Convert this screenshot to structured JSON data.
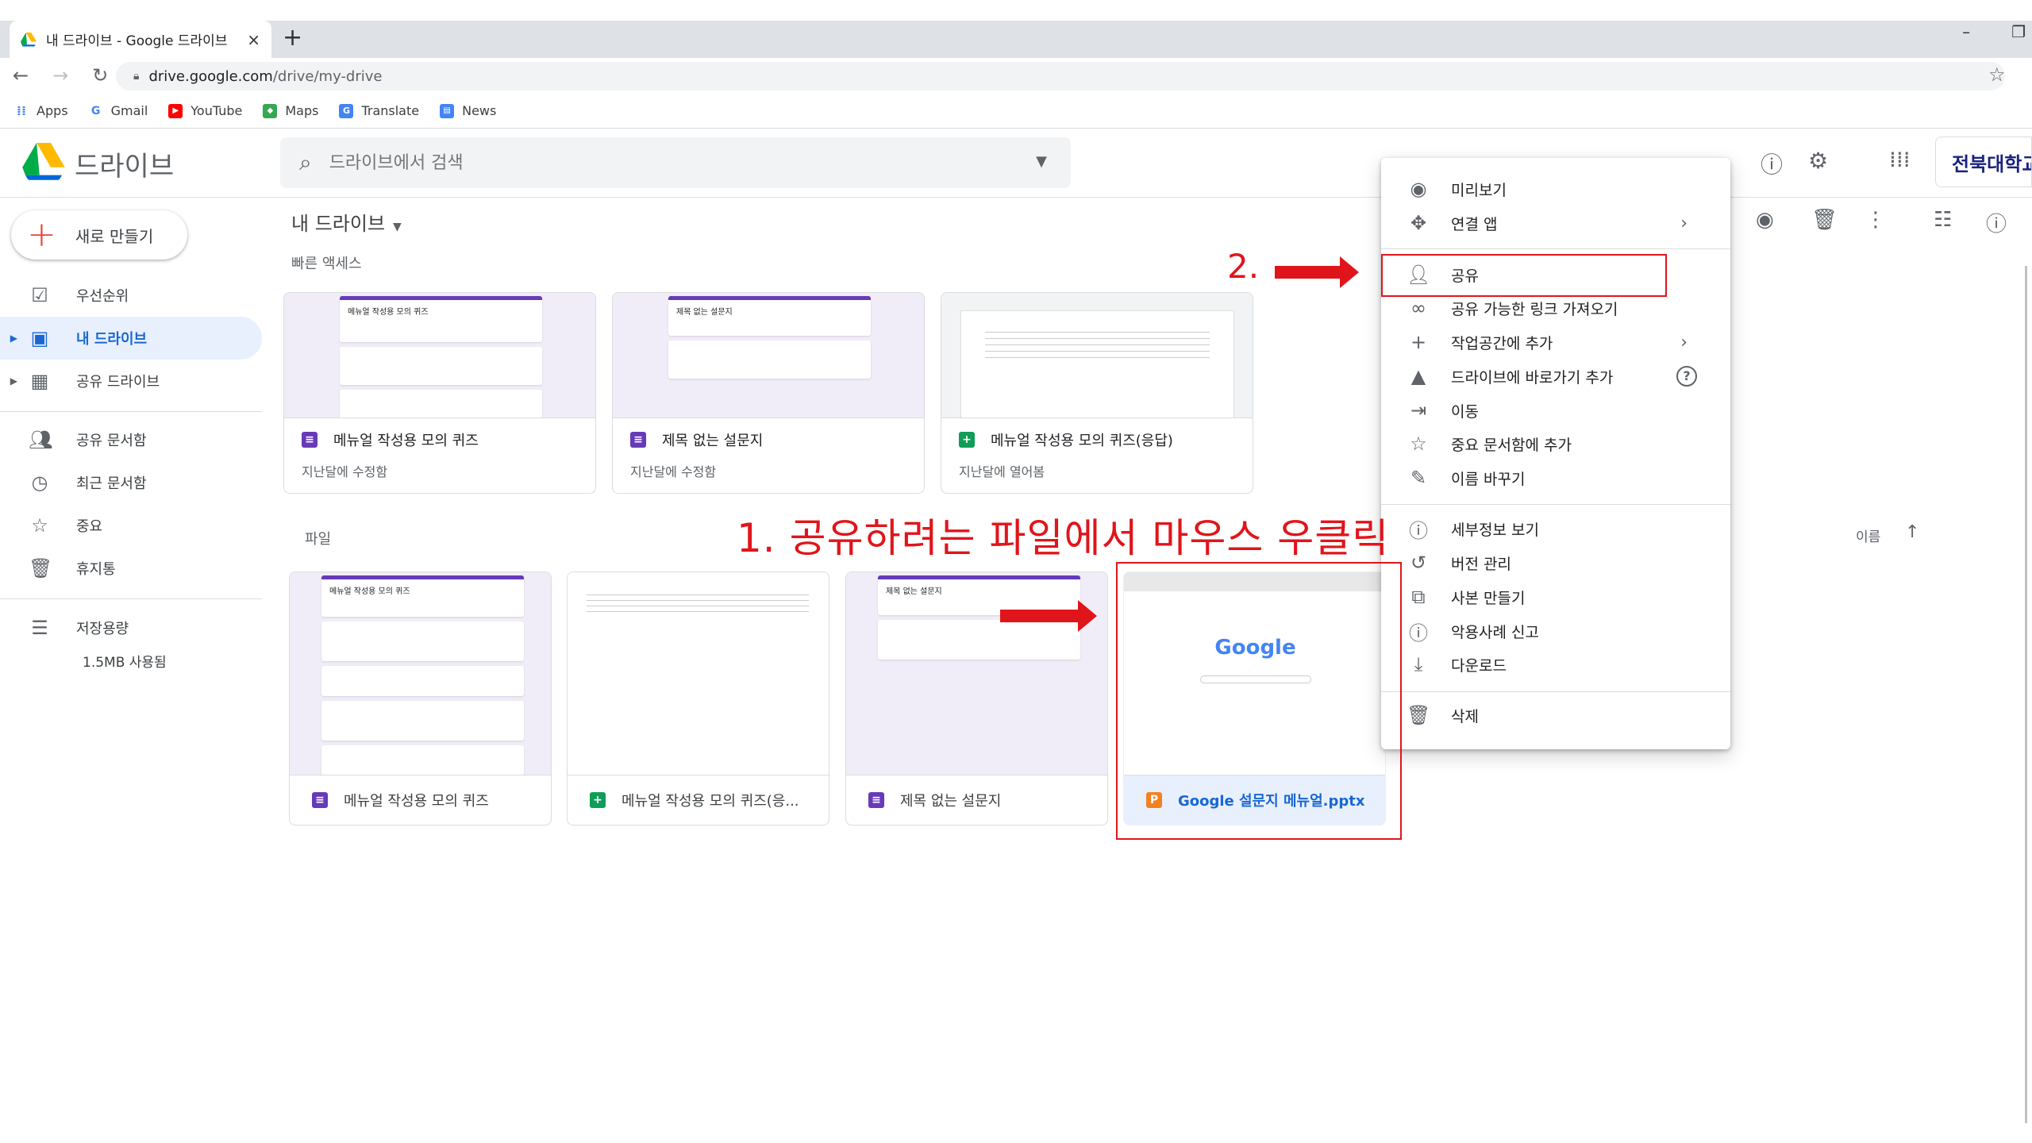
{
  "browser": {
    "tab_title": "내 드라이브 - Google 드라이브",
    "tab_close": "×",
    "new_tab": "+",
    "url_host": "drive.google.com",
    "url_path": "/drive/my-drive",
    "bookmarks": [
      {
        "label": "Apps",
        "icon": "apps-grid-icon",
        "color": "#4285f4"
      },
      {
        "label": "Gmail",
        "icon": "google-g-icon",
        "color": "#ea4335"
      },
      {
        "label": "YouTube",
        "icon": "youtube-icon",
        "color": "#ff0000"
      },
      {
        "label": "Maps",
        "icon": "maps-icon",
        "color": "#34a853"
      },
      {
        "label": "Translate",
        "icon": "translate-icon",
        "color": "#4285f4"
      },
      {
        "label": "News",
        "icon": "news-icon",
        "color": "#4285f4"
      }
    ]
  },
  "drive": {
    "logo_text": "드라이브",
    "search_placeholder": "드라이브에서 검색",
    "school_name": "전북대학교",
    "new_button": "새로 만들기",
    "sidebar": [
      {
        "label": "우선순위",
        "icon": "priority-icon",
        "active": false
      },
      {
        "label": "내 드라이브",
        "icon": "my-drive-icon",
        "active": true
      },
      {
        "label": "공유 드라이브",
        "icon": "shared-drives-icon",
        "active": false
      },
      {
        "label": "공유 문서함",
        "icon": "shared-with-me-icon",
        "active": false
      },
      {
        "label": "최근 문서함",
        "icon": "recent-icon",
        "active": false
      },
      {
        "label": "중요",
        "icon": "starred-icon",
        "active": false
      },
      {
        "label": "휴지통",
        "icon": "trash-icon",
        "active": false
      },
      {
        "label": "저장용량",
        "icon": "storage-icon",
        "active": false
      }
    ],
    "storage_used": "1.5MB 사용됨",
    "breadcrumb": "내 드라이브",
    "quick_access_title": "빠른 액세스",
    "quick_access": [
      {
        "name": "메뉴얼 작성용 모의 퀴즈",
        "sub": "지난달에 수정함",
        "type": "forms",
        "thumb_title": "메뉴얼 작성용 모의 퀴즈"
      },
      {
        "name": "제목 없는 설문지",
        "sub": "지난달에 수정함",
        "type": "forms",
        "thumb_title": "제목 없는 설문지"
      },
      {
        "name": "메뉴얼 작성용 모의 퀴즈(응답)",
        "sub": "지난달에 열어봄",
        "type": "sheets",
        "thumb_title": ""
      }
    ],
    "files_title": "파일",
    "files": [
      {
        "name": "메뉴얼 작성용 모의 퀴즈",
        "type": "forms",
        "thumb_title": "메뉴얼 작성용 모의 퀴즈"
      },
      {
        "name": "메뉴얼 작성용 모의 퀴즈(응...",
        "type": "sheets",
        "thumb_title": ""
      },
      {
        "name": "제목 없는 설문지",
        "type": "forms",
        "thumb_title": "제목 없는 설문지"
      },
      {
        "name": "Google 설문지 메뉴얼.pptx",
        "type": "slides",
        "thumb_title": "Google",
        "selected": true
      }
    ],
    "sort_label": "이름"
  },
  "context_menu": {
    "items": [
      {
        "label": "미리보기",
        "icon": "eye-icon"
      },
      {
        "label": "연결 앱",
        "icon": "open-with-icon",
        "submenu": true
      },
      {
        "label": "공유",
        "icon": "share-person-add-icon",
        "highlight": true
      },
      {
        "label": "공유 가능한 링크 가져오기",
        "icon": "link-icon"
      },
      {
        "label": "작업공간에 추가",
        "icon": "plus-icon",
        "submenu": true
      },
      {
        "label": "드라이브에 바로가기 추가",
        "icon": "add-shortcut-icon",
        "help": true
      },
      {
        "label": "이동",
        "icon": "move-icon"
      },
      {
        "label": "중요 문서함에 추가",
        "icon": "star-icon"
      },
      {
        "label": "이름 바꾸기",
        "icon": "rename-pencil-icon"
      },
      {
        "label": "세부정보 보기",
        "icon": "info-icon"
      },
      {
        "label": "버전 관리",
        "icon": "history-icon"
      },
      {
        "label": "사본 만들기",
        "icon": "copy-icon"
      },
      {
        "label": "악용사례 신고",
        "icon": "report-icon"
      },
      {
        "label": "다운로드",
        "icon": "download-icon"
      },
      {
        "label": "삭제",
        "icon": "trash-icon"
      }
    ]
  },
  "annotations": {
    "step1": "1. 공유하려는 파일에서 마우스 우클릭",
    "step2": "2."
  }
}
